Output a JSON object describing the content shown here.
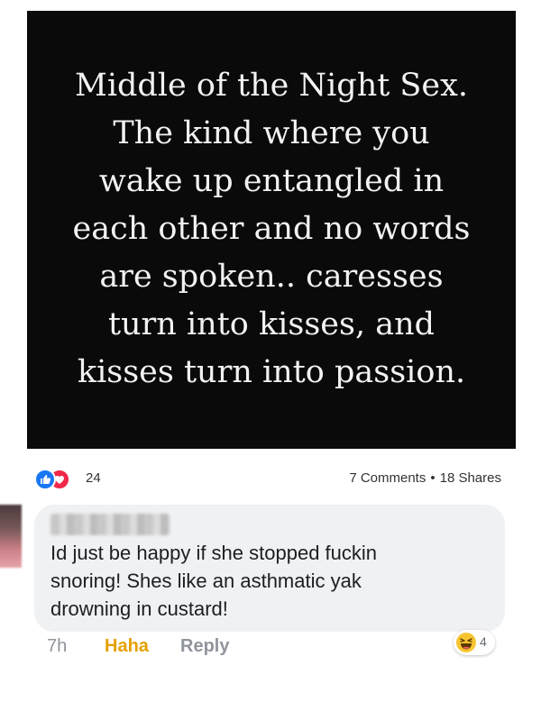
{
  "post": {
    "image_text_lines": [
      "Middle of the Night Sex.",
      "The kind where you",
      "wake up entangled in",
      "each other and no words",
      "are spoken.. caresses",
      "turn into kisses, and",
      "kisses turn into passion."
    ],
    "reaction_icons": [
      "like-icon",
      "love-icon"
    ],
    "reaction_count": "24",
    "comments_label": "7 Comments",
    "separator": "•",
    "shares_label": "18 Shares"
  },
  "comment": {
    "text_lines": [
      "Id just be happy if she stopped fuckin",
      "snoring! Shes like an asthmatic yak",
      "drowning in custard!"
    ],
    "time": "7h",
    "haha_label": "Haha",
    "reply_label": "Reply",
    "reaction_icon": "haha-icon",
    "reaction_count": "4"
  },
  "colors": {
    "image_background": "#0a0a0a",
    "like_blue": "#1877f2",
    "love_red": "#f02849",
    "haha_yellow": "#e5a000",
    "bubble_gray": "#f0f1f3"
  }
}
